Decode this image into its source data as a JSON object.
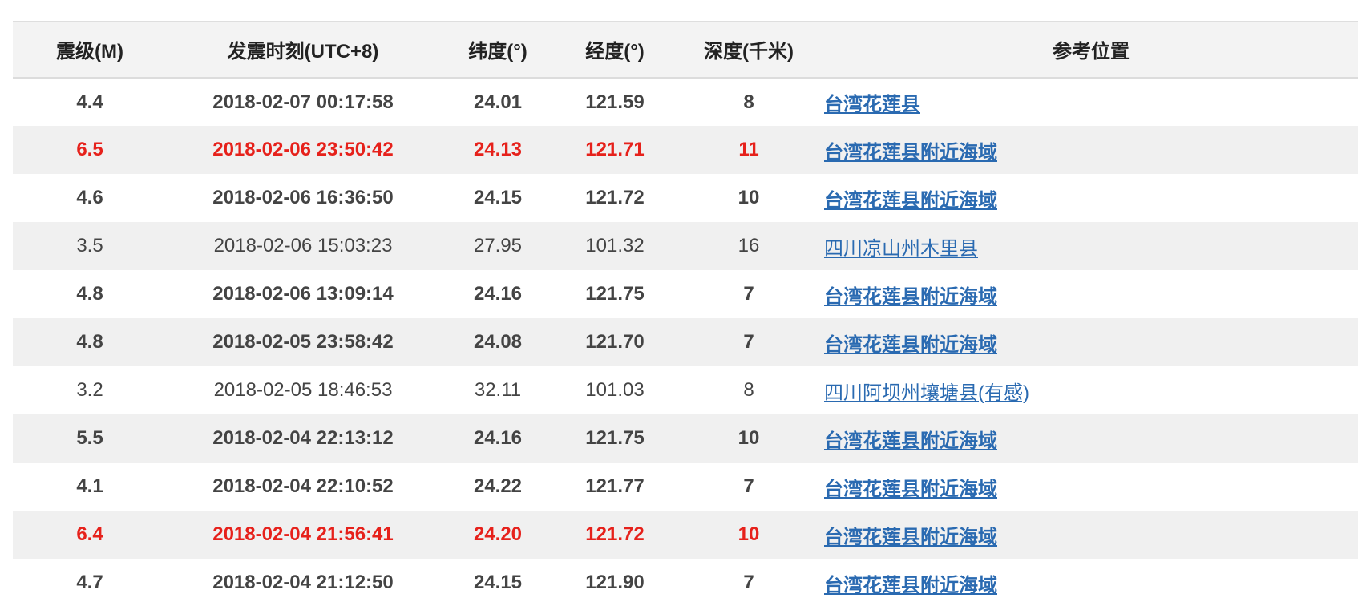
{
  "table": {
    "headers": [
      "震级(M)",
      "发震时刻(UTC+8)",
      "纬度(°)",
      "经度(°)",
      "深度(千米)",
      "参考位置"
    ],
    "rows": [
      {
        "mag": "4.4",
        "time": "2018-02-07 00:17:58",
        "lat": "24.01",
        "lon": "121.59",
        "depth": "8",
        "location": "台湾花莲县",
        "style": "bold"
      },
      {
        "mag": "6.5",
        "time": "2018-02-06 23:50:42",
        "lat": "24.13",
        "lon": "121.71",
        "depth": "11",
        "location": "台湾花莲县附近海域",
        "style": "bold-red"
      },
      {
        "mag": "4.6",
        "time": "2018-02-06 16:36:50",
        "lat": "24.15",
        "lon": "121.72",
        "depth": "10",
        "location": "台湾花莲县附近海域",
        "style": "bold"
      },
      {
        "mag": "3.5",
        "time": "2018-02-06 15:03:23",
        "lat": "27.95",
        "lon": "101.32",
        "depth": "16",
        "location": "四川凉山州木里县",
        "style": "normal"
      },
      {
        "mag": "4.8",
        "time": "2018-02-06 13:09:14",
        "lat": "24.16",
        "lon": "121.75",
        "depth": "7",
        "location": "台湾花莲县附近海域",
        "style": "bold"
      },
      {
        "mag": "4.8",
        "time": "2018-02-05 23:58:42",
        "lat": "24.08",
        "lon": "121.70",
        "depth": "7",
        "location": "台湾花莲县附近海域",
        "style": "bold"
      },
      {
        "mag": "3.2",
        "time": "2018-02-05 18:46:53",
        "lat": "32.11",
        "lon": "101.03",
        "depth": "8",
        "location": "四川阿坝州壤塘县(有感)",
        "style": "normal"
      },
      {
        "mag": "5.5",
        "time": "2018-02-04 22:13:12",
        "lat": "24.16",
        "lon": "121.75",
        "depth": "10",
        "location": "台湾花莲县附近海域",
        "style": "bold"
      },
      {
        "mag": "4.1",
        "time": "2018-02-04 22:10:52",
        "lat": "24.22",
        "lon": "121.77",
        "depth": "7",
        "location": "台湾花莲县附近海域",
        "style": "bold"
      },
      {
        "mag": "6.4",
        "time": "2018-02-04 21:56:41",
        "lat": "24.20",
        "lon": "121.72",
        "depth": "10",
        "location": "台湾花莲县附近海域",
        "style": "bold-red"
      },
      {
        "mag": "4.7",
        "time": "2018-02-04 21:12:50",
        "lat": "24.15",
        "lon": "121.90",
        "depth": "7",
        "location": "台湾花莲县附近海域",
        "style": "bold"
      }
    ]
  },
  "colors": {
    "header_bg": "#f3f3f3",
    "stripe_bg": "#f0f0f0",
    "text": "#444444",
    "highlight_red": "#e6211b",
    "link_blue": "#2a6ab1"
  }
}
